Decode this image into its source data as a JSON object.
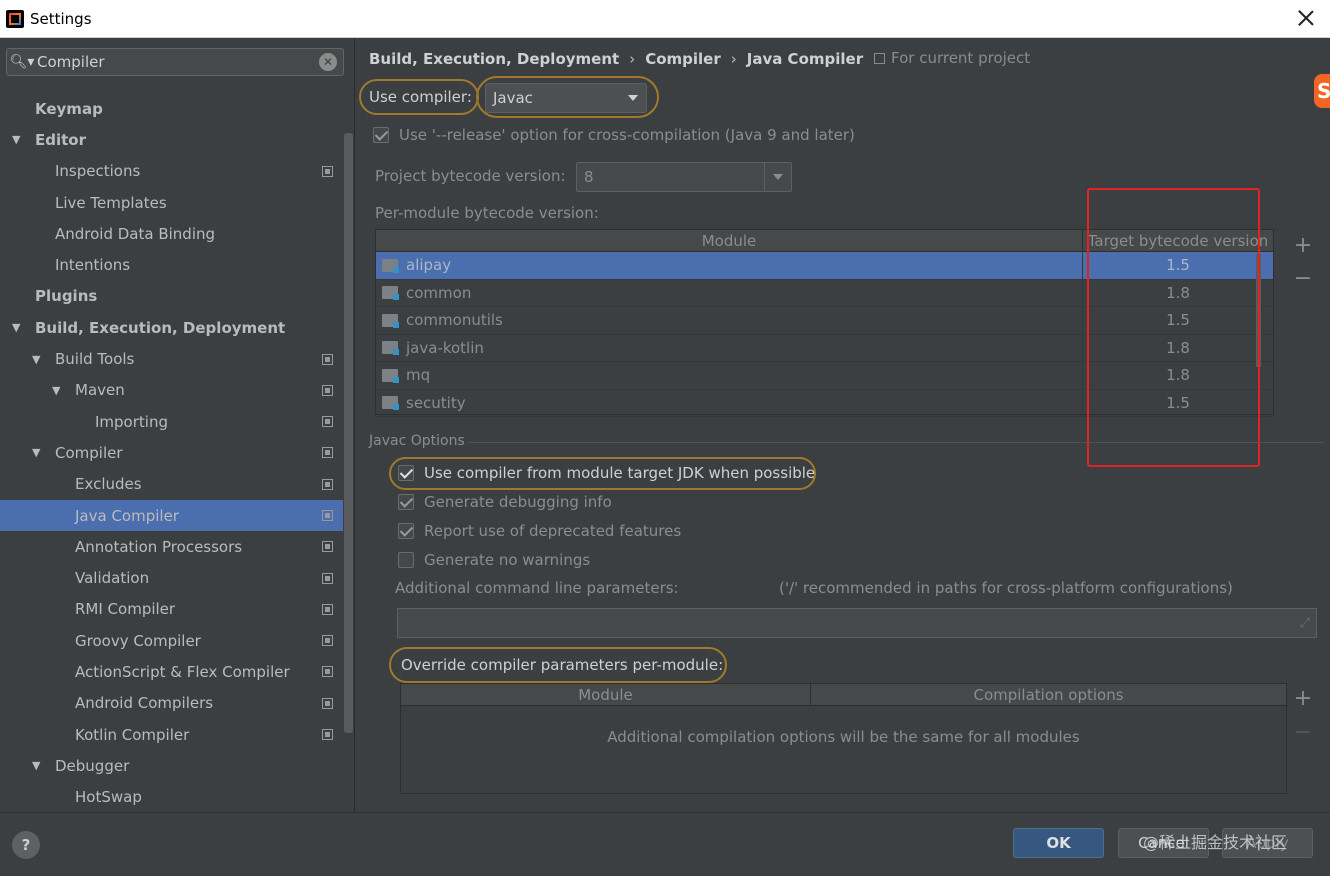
{
  "window": {
    "title": "Settings"
  },
  "search": {
    "value": "Compiler"
  },
  "sidebar": {
    "items": [
      {
        "label": "Keymap",
        "bold": true,
        "level": 0,
        "arrow": ""
      },
      {
        "label": "Editor",
        "bold": true,
        "level": 0,
        "arrow": "▼"
      },
      {
        "label": "Inspections",
        "bold": false,
        "level": 1,
        "arrow": "",
        "page_icon": true
      },
      {
        "label": "Live Templates",
        "bold": false,
        "level": 1,
        "arrow": ""
      },
      {
        "label": "Android Data Binding",
        "bold": false,
        "level": 1,
        "arrow": ""
      },
      {
        "label": "Intentions",
        "bold": false,
        "level": 1,
        "arrow": ""
      },
      {
        "label": "Plugins",
        "bold": true,
        "level": 0,
        "arrow": ""
      },
      {
        "label": "Build, Execution, Deployment",
        "bold": true,
        "level": 0,
        "arrow": "▼"
      },
      {
        "label": "Build Tools",
        "bold": false,
        "level": 1,
        "arrow": "▼",
        "page_icon": true
      },
      {
        "label": "Maven",
        "bold": false,
        "level": 2,
        "arrow": "▼",
        "page_icon": true
      },
      {
        "label": "Importing",
        "bold": false,
        "level": 3,
        "arrow": "",
        "page_icon": true
      },
      {
        "label": "Compiler",
        "bold": false,
        "level": 1,
        "arrow": "▼",
        "page_icon": true
      },
      {
        "label": "Excludes",
        "bold": false,
        "level": 2,
        "arrow": "",
        "page_icon": true
      },
      {
        "label": "Java Compiler",
        "bold": false,
        "level": 2,
        "arrow": "",
        "page_icon": true,
        "selected": true
      },
      {
        "label": "Annotation Processors",
        "bold": false,
        "level": 2,
        "arrow": "",
        "page_icon": true
      },
      {
        "label": "Validation",
        "bold": false,
        "level": 2,
        "arrow": "",
        "page_icon": true
      },
      {
        "label": "RMI Compiler",
        "bold": false,
        "level": 2,
        "arrow": "",
        "page_icon": true
      },
      {
        "label": "Groovy Compiler",
        "bold": false,
        "level": 2,
        "arrow": "",
        "page_icon": true
      },
      {
        "label": "ActionScript & Flex Compiler",
        "bold": false,
        "level": 2,
        "arrow": "",
        "page_icon": true
      },
      {
        "label": "Android Compilers",
        "bold": false,
        "level": 2,
        "arrow": "",
        "page_icon": true
      },
      {
        "label": "Kotlin Compiler",
        "bold": false,
        "level": 2,
        "arrow": "",
        "page_icon": true
      },
      {
        "label": "Debugger",
        "bold": false,
        "level": 1,
        "arrow": "▼"
      },
      {
        "label": "HotSwap",
        "bold": false,
        "level": 2,
        "arrow": ""
      }
    ]
  },
  "breadcrumb": {
    "part1": "Build, Execution, Deployment",
    "part2": "Compiler",
    "part3": "Java Compiler",
    "separator": "›"
  },
  "scope_note": "For current project",
  "use_compiler": {
    "label": "Use compiler:",
    "value": "Javac"
  },
  "release_option": {
    "label": "Use '--release' option for cross-compilation (Java 9 and later)",
    "checked": true
  },
  "project_bytecode": {
    "label": "Project bytecode version:",
    "value": "8"
  },
  "per_module": {
    "label": "Per-module bytecode version:",
    "columns": [
      "Module",
      "Target bytecode version"
    ],
    "rows": [
      {
        "module": "alipay",
        "version": "1.5"
      },
      {
        "module": "common",
        "version": "1.8"
      },
      {
        "module": "commonutils",
        "version": "1.5"
      },
      {
        "module": "java-kotlin",
        "version": "1.8"
      },
      {
        "module": "mq",
        "version": "1.8"
      },
      {
        "module": "secutity",
        "version": "1.5"
      }
    ],
    "add_symbol": "+",
    "remove_symbol": "−"
  },
  "javac_options": {
    "title": "Javac Options",
    "use_module_jdk": "Use compiler from module target JDK when possible",
    "debug_info": "Generate debugging info",
    "deprecated": "Report use of deprecated features",
    "no_warnings": "Generate no warnings",
    "additional_label": "Additional command line parameters:",
    "additional_hint": "('/' recommended in paths for cross-platform configurations)",
    "additional_value": ""
  },
  "override": {
    "label": "Override compiler parameters per-module:",
    "columns": [
      "Module",
      "Compilation options"
    ],
    "empty_text": "Additional compilation options will be the same for all modules",
    "add_symbol": "+",
    "remove_symbol": "−"
  },
  "footer": {
    "help": "?",
    "ok": "OK",
    "cancel": "Cancel",
    "apply": "Apply",
    "watermark": "@稀土掘金技术社区"
  },
  "colors": {
    "accent": "#4b6eaf",
    "highlight_ring": "#a07a2c",
    "red_box": "#e02424"
  }
}
